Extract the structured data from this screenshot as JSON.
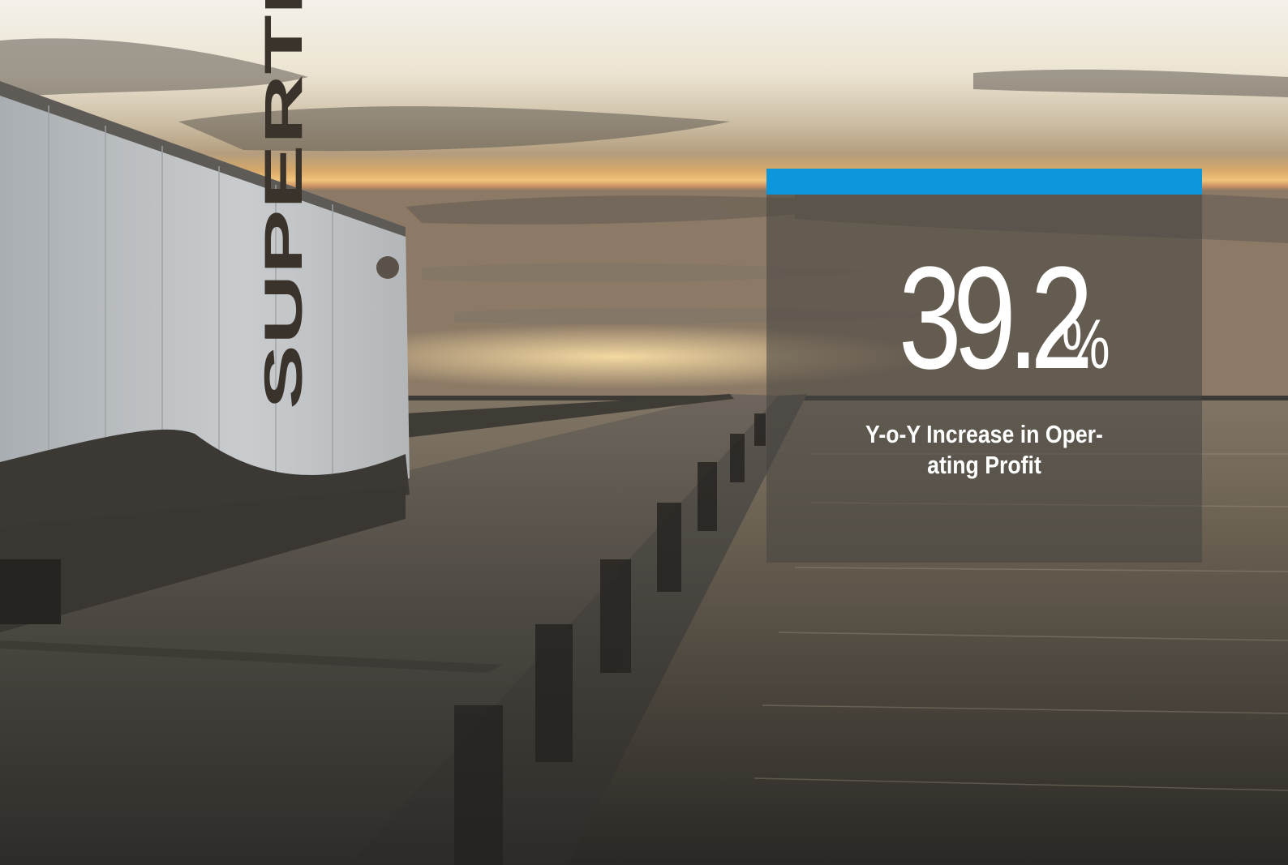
{
  "photo": {
    "trailer_brand": "SUPERTRUCK",
    "subject": "trailer-truck-on-bridge-at-sunset"
  },
  "stat": {
    "value": "39.2",
    "unit": "%",
    "caption_line1": "Y-o-Y Increase in Oper-",
    "caption_line2": "ating Profit"
  },
  "colors": {
    "accent": "#0d96dc",
    "card_overlay": "rgba(70,68,64,0.55)",
    "text": "#ffffff"
  }
}
